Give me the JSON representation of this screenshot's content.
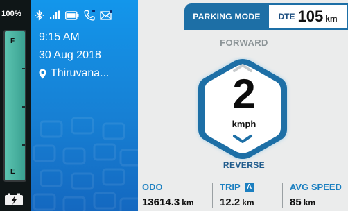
{
  "battery": {
    "percent_text": "100%",
    "level": 1.0,
    "full_mark": "F",
    "empty_mark": "E"
  },
  "status_bar": {
    "icons": [
      "bluetooth-icon",
      "signal-icon",
      "battery-icon",
      "phone-icon",
      "mail-icon"
    ]
  },
  "info": {
    "time": "9:15 AM",
    "date": "30 Aug 2018",
    "location": "Thiruvana..."
  },
  "dashboard": {
    "mode": "PARKING MODE",
    "dte_label": "DTE",
    "dte_value": "105",
    "dte_unit": "km",
    "gear_forward": "FORWARD",
    "gear_reverse": "REVERSE",
    "speed": "2",
    "speed_unit": "kmph"
  },
  "stats": {
    "odo": {
      "label": "ODO",
      "value": "13614.3",
      "unit": "km"
    },
    "trip": {
      "label": "TRIP",
      "badge": "A",
      "value": "12.2",
      "unit": "km"
    },
    "avg": {
      "label": "AVG SPEED",
      "value": "85",
      "unit": "km"
    }
  },
  "colors": {
    "accent": "#1d6fa6",
    "panel_blue": "#1396eb",
    "battery_fill": "#4cb4a3",
    "background": "#ebecec"
  }
}
